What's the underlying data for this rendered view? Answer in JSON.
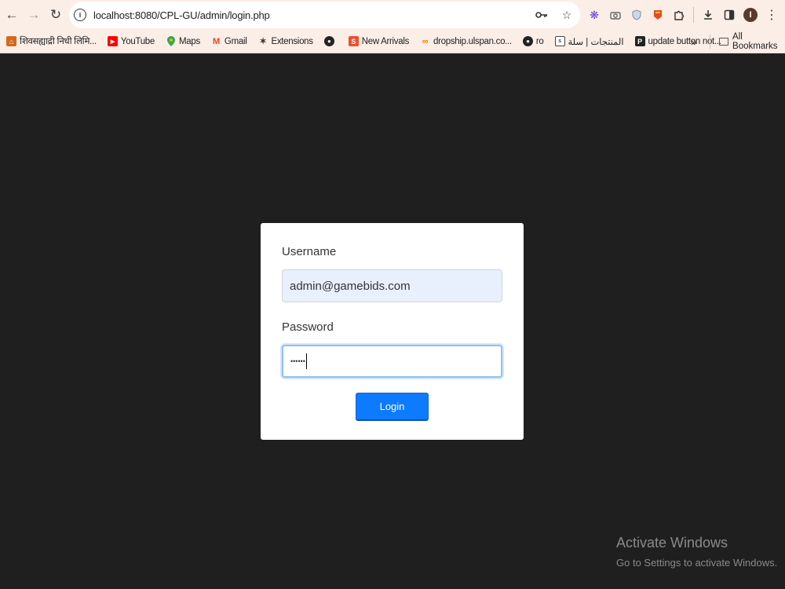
{
  "browser": {
    "url": "localhost:8080/CPL-GU/admin/login.php",
    "back_icon": "back-arrow-icon",
    "forward_icon": "forward-arrow-icon",
    "reload_icon": "reload-icon",
    "bookmarks": [
      {
        "label": "शिवसह्याद्री निधी लिमि...",
        "icon_color": "#d2691e"
      },
      {
        "label": "YouTube",
        "icon_color": "#ff0000"
      },
      {
        "label": "Maps",
        "icon_color": "#34a853"
      },
      {
        "label": "Gmail",
        "icon_color": "#ea4335"
      },
      {
        "label": "Extensions",
        "icon_color": "#333333"
      },
      {
        "label": "",
        "icon_color": "#222222"
      },
      {
        "label": "New Arrivals",
        "icon_color": "#ee4d2d"
      },
      {
        "label": "dropship.ulspan.co...",
        "icon_color": "#f57c00"
      },
      {
        "label": "ro",
        "icon_color": "#222222"
      },
      {
        "label": "المنتجات | سلة",
        "icon_color": "#444444"
      },
      {
        "label": "update button not...",
        "icon_color": "#222222"
      }
    ],
    "more_bookmarks": "»",
    "all_bookmarks": "All Bookmarks",
    "avatar_letter": "I"
  },
  "login": {
    "username_label": "Username",
    "username_value": "admin@gamebids.com",
    "password_label": "Password",
    "password_mask": "••••••",
    "button_label": "Login"
  },
  "watermark": {
    "title": "Activate Windows",
    "subtitle": "Go to Settings to activate Windows."
  },
  "colors": {
    "page_background": "#1f1f1f",
    "button": "#0d7bff",
    "autofill": "#e8f0fe"
  }
}
